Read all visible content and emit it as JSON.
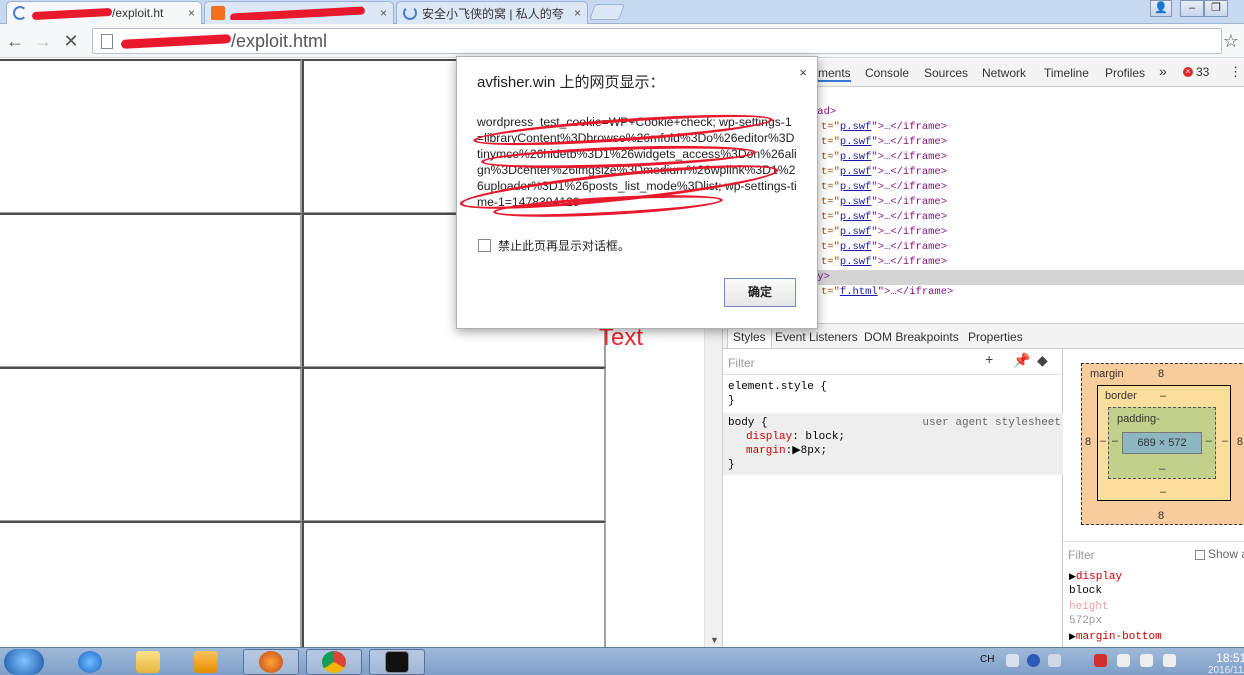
{
  "browser": {
    "tabs": [
      {
        "title": "/exploit.ht",
        "close": "×",
        "active": true
      },
      {
        "title": "",
        "close": "×",
        "active": false
      },
      {
        "title": "安全小飞侠的窝 | 私人的夸",
        "close": "×",
        "active": false
      }
    ],
    "address": {
      "url_suffix": "/exploit.html"
    },
    "nav": {
      "back": "←",
      "forward": "→",
      "stop": "✕",
      "star": "☆"
    }
  },
  "page": {
    "overlay_text": "Text"
  },
  "dialog": {
    "title": "avfisher.win 上的网页显示：",
    "close": "×",
    "message": "wordpress_test_cookie=WP+Cookie+check; wp-settings-1=libraryContent%3Dbrowse%26mfold%3Do%26editor%3Dtinymce%26hidetb%3D1%26widgets_access%3Don%26align%3Dcenter%26imgsize%3Dmedium%26wplink%3D1%26uploader%3D1%26posts_list_mode%3Dlist; wp-settings-time-1=1478394129",
    "checkbox_label": "禁止此页再显示对话框。",
    "ok_label": "确定"
  },
  "devtools": {
    "tabs": [
      "ments",
      "Console",
      "Sources",
      "Network",
      "Timeline",
      "Profiles"
    ],
    "more": "»",
    "error_count": "33",
    "elements": {
      "head_close": "ead>",
      "iframe_attr": "t=\"",
      "iframe_src": "p.swf",
      "iframe_tail": "\">…</iframe>",
      "body_close": "dy>",
      "last_src": "f.html"
    },
    "lower_tabs": [
      "Styles",
      "Event Listeners",
      "DOM Breakpoints",
      "Properties"
    ],
    "styles": {
      "filter_placeholder": "Filter",
      "element_style": "element.style {",
      "close_brace": "}",
      "body_selector": "body {",
      "sheet": "user agent stylesheet",
      "display_name": "display",
      "display_value": ": block;",
      "margin_name": "margin",
      "margin_value": ":▶8px;"
    },
    "box_model": {
      "margin_label": "margin",
      "margin_value": "8",
      "border_label": "border",
      "border_value": "–",
      "padding_label": "padding-",
      "padding_value": "–",
      "side_value": "8",
      "dash": "–",
      "content": "689 × 572"
    },
    "computed": {
      "filter_placeholder": "Filter",
      "show_all": "Show a",
      "props": [
        {
          "name": "display",
          "value": "block"
        },
        {
          "name": "height",
          "value": "572px"
        },
        {
          "name": "margin-bottom",
          "value": ""
        }
      ]
    }
  },
  "taskbar": {
    "ime": "CH",
    "time": "18:51",
    "date": "2016/11/"
  },
  "colors": {
    "accent": "#3879d9",
    "annotation_red": "#e8192c",
    "taskbar": "#8aa9d1"
  }
}
